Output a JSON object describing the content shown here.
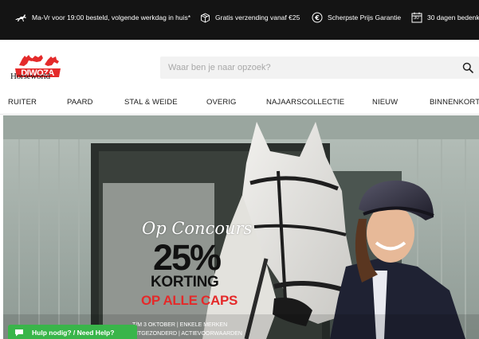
{
  "usp_bar": {
    "items": [
      {
        "icon": "horse-icon",
        "text": "Ma-Vr voor 19:00 besteld, volgende werkdag in huis*"
      },
      {
        "icon": "package-icon",
        "text": "Gratis verzending vanaf €25"
      },
      {
        "icon": "euro-icon",
        "text": "Scherpste Prijs Garantie"
      },
      {
        "icon": "calendar-icon",
        "text": "30 dagen bedenk"
      }
    ],
    "calendar_number": "30"
  },
  "header": {
    "logo_text": "Horseworld",
    "search_placeholder": "Waar ben je naar opzoek?",
    "search_value": ""
  },
  "nav": {
    "items": [
      "RUITER",
      "PAARD",
      "STAL & WEIDE",
      "OVERIG",
      "NAJAARSCOLLECTIE",
      "NIEUW",
      "BINNENKORT"
    ]
  },
  "promo": {
    "script": "Op Concours",
    "percent": "25%",
    "korting": "KORTING",
    "caps": "OP ALLE CAPS",
    "fine_1": "T/M 3 OKTOBER | ENKELE MERKEN",
    "fine_2": "UITGEZONDERD | ACTIEVOORWAARDEN"
  },
  "help": {
    "label": "Hulp nodig? / Need Help?"
  },
  "colors": {
    "top_bar": "#141414",
    "accent_red": "#e42a2a",
    "help_green": "#39b54a"
  }
}
